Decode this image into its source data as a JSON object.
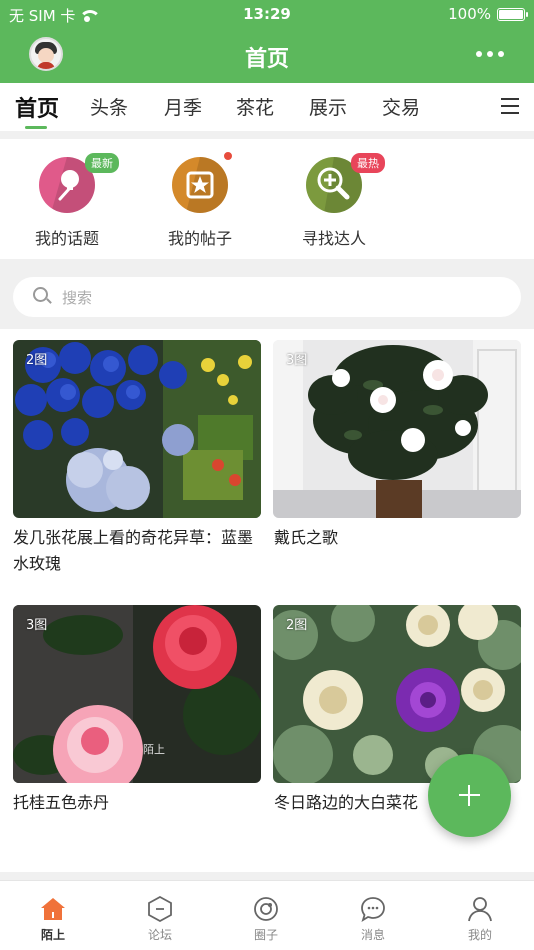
{
  "status_bar": {
    "carrier": "无 SIM 卡",
    "time": "13:29",
    "battery": "100%"
  },
  "header": {
    "title": "首页"
  },
  "tabs": [
    {
      "label": "首页",
      "active": true
    },
    {
      "label": "头条"
    },
    {
      "label": "月季"
    },
    {
      "label": "茶花"
    },
    {
      "label": "展示"
    },
    {
      "label": "交易"
    }
  ],
  "quick_actions": [
    {
      "label": "我的话题",
      "badge": "最新",
      "icon": "pin-icon",
      "color": "#e05a8a"
    },
    {
      "label": "我的帖子",
      "icon": "star-icon",
      "color": "#d4892a"
    },
    {
      "label": "寻找达人",
      "badge": "最热",
      "icon": "magnify-plus-icon",
      "color": "#7c9a3e"
    }
  ],
  "search": {
    "placeholder": "搜索"
  },
  "posts": [
    {
      "count": "2图",
      "title": "发几张花展上看的奇花异草：蓝墨水玫瑰"
    },
    {
      "count": "3图",
      "title": "戴氏之歌"
    },
    {
      "count": "3图",
      "title": "托桂五色赤丹"
    },
    {
      "count": "2图",
      "title": "冬日路边的大白菜花"
    }
  ],
  "fab": {
    "icon": "plus-icon"
  },
  "bottom_nav": [
    {
      "label": "陌上",
      "icon": "home-icon",
      "active": true
    },
    {
      "label": "论坛",
      "icon": "forum-icon"
    },
    {
      "label": "圈子",
      "icon": "circle-icon"
    },
    {
      "label": "消息",
      "icon": "message-icon"
    },
    {
      "label": "我的",
      "icon": "user-icon"
    }
  ],
  "colors": {
    "brand_green": "#5cb85c",
    "badge_green": "#5cb85c",
    "badge_red": "#e8455a"
  }
}
